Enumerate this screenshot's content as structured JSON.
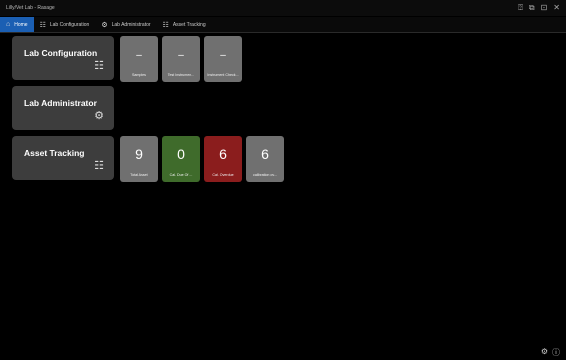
{
  "app": {
    "title": "Lilly/Vet Lab - Rasage"
  },
  "window_controls": [
    {
      "name": "help-icon",
      "glyph": "⍰"
    },
    {
      "name": "restore-icon",
      "glyph": "⧉"
    },
    {
      "name": "resize-icon",
      "glyph": "⊡"
    },
    {
      "name": "close-icon",
      "glyph": "✕"
    }
  ],
  "tabs": [
    {
      "label": "Home",
      "icon": "home-icon",
      "glyph": "⌂",
      "active": true
    },
    {
      "label": "Lab Configuration",
      "icon": "config-icon",
      "glyph": "☷",
      "active": false
    },
    {
      "label": "Lab Administrator",
      "icon": "admin-icon",
      "glyph": "⚙",
      "active": false
    },
    {
      "label": "Asset Tracking",
      "icon": "asset-icon",
      "glyph": "☷",
      "active": false
    }
  ],
  "modules": [
    {
      "label": "Lab Configuration",
      "icon": "config-icon",
      "tiles": [
        {
          "value": "–",
          "caption": "Samples",
          "color": "#707070"
        },
        {
          "value": "–",
          "caption": "Test Instrumen...",
          "color": "#707070"
        },
        {
          "value": "–",
          "caption": "Instrument Check...",
          "color": "#707070"
        }
      ]
    },
    {
      "label": "Lab Administrator",
      "icon": "gear-icon",
      "tiles": []
    },
    {
      "label": "Asset Tracking",
      "icon": "asset-icon",
      "tiles": [
        {
          "value": "9",
          "caption": "Total Asset",
          "color": "#707070"
        },
        {
          "value": "0",
          "caption": "Cal. Due Of ...",
          "color": "#3f6b2b"
        },
        {
          "value": "6",
          "caption": "Cal. Overdue",
          "color": "#8b1d1d"
        },
        {
          "value": "6",
          "caption": "calibration ov...",
          "color": "#707070"
        }
      ]
    }
  ],
  "status_icons": [
    {
      "name": "settings-icon",
      "glyph": "⚙"
    },
    {
      "name": "info-icon",
      "glyph": "ⓘ"
    }
  ]
}
